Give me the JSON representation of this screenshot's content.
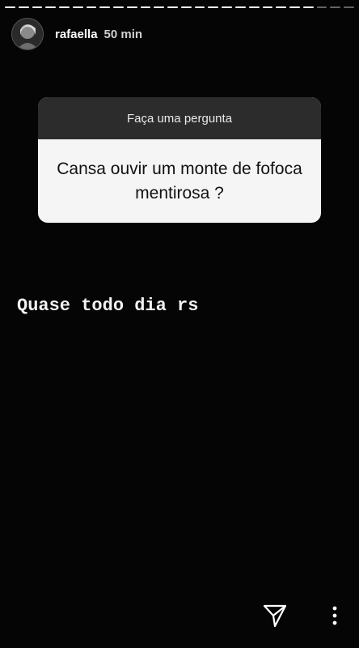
{
  "story": {
    "progress": {
      "total_segments": 26,
      "seen_segments": 23
    },
    "user": {
      "username": "rafaella",
      "time_ago": "50 min"
    },
    "question_sticker": {
      "header": "Faça uma pergunta",
      "question": "Cansa ouvir um monte de fofoca mentirosa ?"
    },
    "answer_text": "Quase todo dia rs",
    "icons": {
      "send": "send-icon",
      "more": "more-options-icon"
    }
  }
}
